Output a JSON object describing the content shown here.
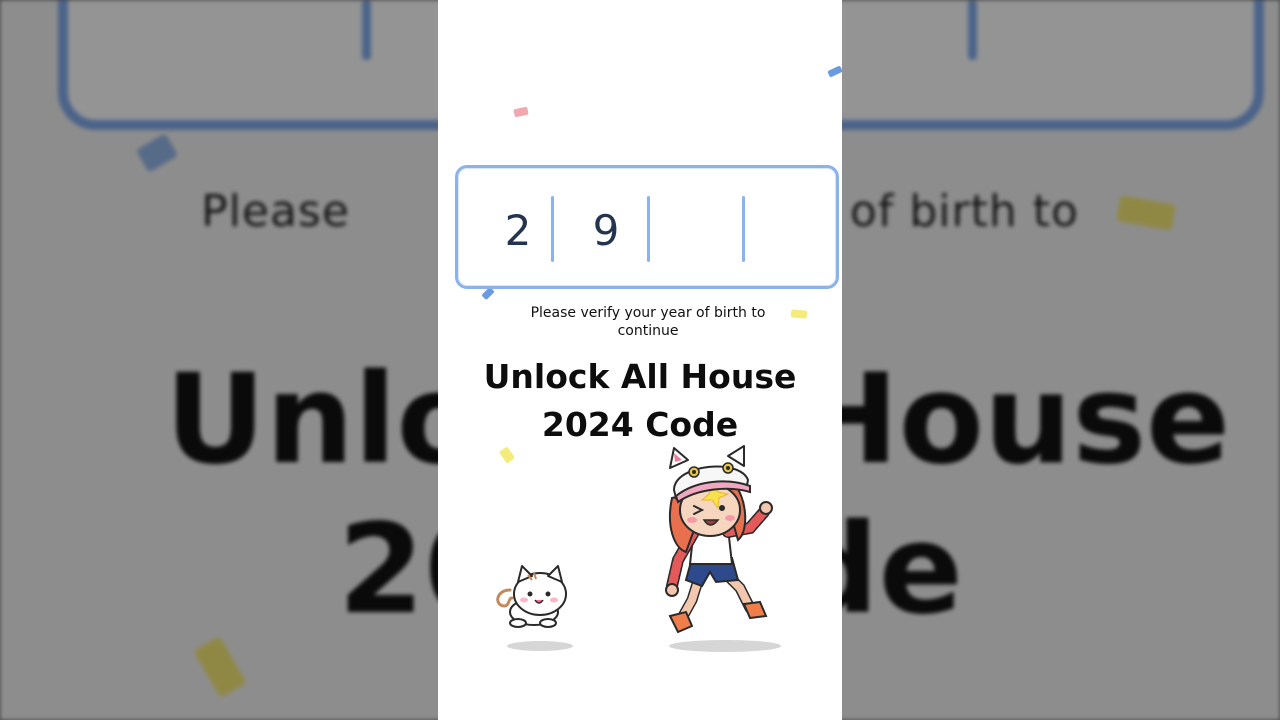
{
  "code_entry": {
    "digits": [
      "2",
      "9",
      "",
      ""
    ]
  },
  "prompt_text": "Please verify your year of birth to continue",
  "title_line1": "Unlock All House",
  "title_line2": "2024 Code",
  "background": {
    "prompt_fragment_left": "Please",
    "prompt_fragment_right": "of birth to",
    "title_fragment_line1_left": "Unlo",
    "title_fragment_line1_right": "House",
    "title_fragment_line2_left": "20",
    "title_fragment_line2_right": "de"
  },
  "colors": {
    "accent_blue": "#8cb2ea",
    "digit_text": "#24344f",
    "panel_bg": "#ffffff"
  },
  "icons": [
    "cat-icon",
    "girl-character-icon",
    "confetti-icon"
  ]
}
